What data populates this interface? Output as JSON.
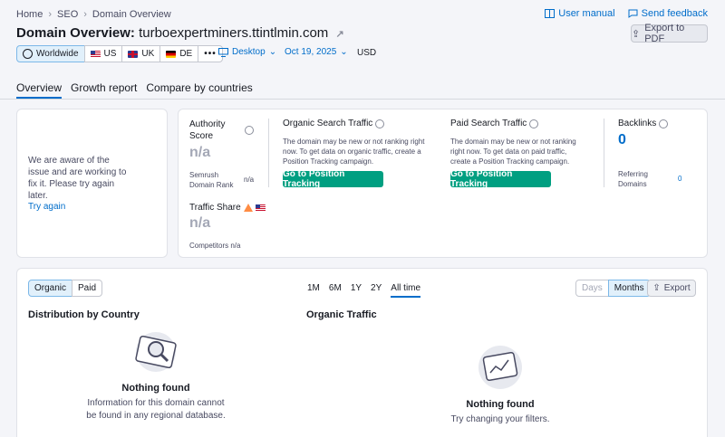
{
  "breadcrumb": [
    "Home",
    "SEO",
    "Domain Overview"
  ],
  "toplinks": {
    "manual": "User manual",
    "feedback": "Send feedback"
  },
  "title": {
    "prefix": "Domain Overview:",
    "domain": "turboexpertminers.ttintlmin.com"
  },
  "export_pdf": "Export to PDF",
  "databases": [
    {
      "label": "Worldwide",
      "icon": "globe-icon"
    },
    {
      "label": "US",
      "icon": "us-flag-icon"
    },
    {
      "label": "UK",
      "icon": "uk-flag-icon"
    },
    {
      "label": "DE",
      "icon": "de-flag-icon"
    }
  ],
  "more_label": "•••",
  "device": "Desktop",
  "date": "Oct 19, 2025",
  "currency": "USD",
  "tabs": [
    "Overview",
    "Growth report",
    "Compare by countries"
  ],
  "error_card": {
    "message": "We are aware of the issue and are working to fix it. Please try again later.",
    "retry": "Try again"
  },
  "authority": {
    "label": "Authority Score",
    "value": "n/a",
    "rank_label": "Semrush Domain Rank",
    "rank_value": "n/a"
  },
  "traffic_share": {
    "label": "Traffic Share",
    "value": "n/a",
    "competitors_label": "Competitors",
    "competitors_value": "n/a"
  },
  "organic": {
    "label": "Organic Search Traffic",
    "note": "The domain may be new or not ranking right now. To get data on organic traffic, create a Position Tracking campaign.",
    "button": "Go to Position Tracking"
  },
  "paid": {
    "label": "Paid Search Traffic",
    "note": "The domain may be new or not ranking right now. To get data on paid traffic, create a Position Tracking campaign.",
    "button": "Go to Position Tracking"
  },
  "backlinks": {
    "label": "Backlinks",
    "value": "0",
    "referring_label": "Referring Domains",
    "referring_value": "0"
  },
  "bottom": {
    "segment": [
      "Organic",
      "Paid"
    ],
    "periods": [
      "1M",
      "6M",
      "1Y",
      "2Y",
      "All time"
    ],
    "granularity": [
      "Days",
      "Months"
    ],
    "export": "Export",
    "distribution_title": "Distribution by Country",
    "distribution_empty_title": "Nothing found",
    "distribution_empty_sub": "Information for this domain cannot be found in any regional database.",
    "traffic_title": "Organic Traffic",
    "traffic_empty_title": "Nothing found",
    "traffic_empty_sub": "Try changing your filters."
  }
}
